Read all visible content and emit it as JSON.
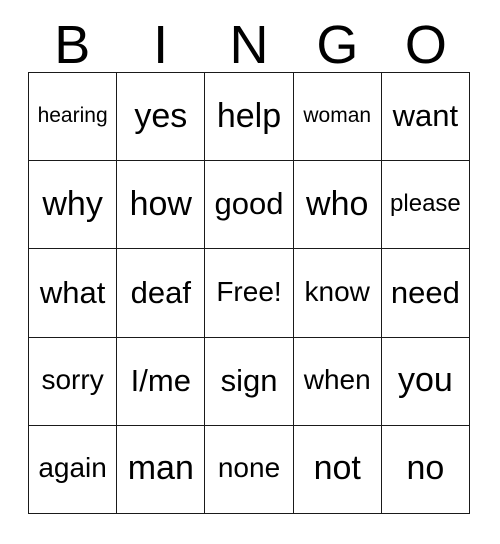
{
  "card": {
    "title_letters": [
      "B",
      "I",
      "N",
      "G",
      "O"
    ],
    "columns": 5,
    "rows": 5,
    "free_space_label": "Free!",
    "colors": {
      "background": "#ffffff",
      "border": "#1a1a1a",
      "text": "#000000"
    },
    "grid": [
      [
        {
          "text": "hearing",
          "size": "xs"
        },
        {
          "text": "yes",
          "size": "xl"
        },
        {
          "text": "help",
          "size": "xl"
        },
        {
          "text": "woman",
          "size": "xs"
        },
        {
          "text": "want",
          "size": "lg"
        }
      ],
      [
        {
          "text": "why",
          "size": "xl"
        },
        {
          "text": "how",
          "size": "xl"
        },
        {
          "text": "good",
          "size": "lg"
        },
        {
          "text": "who",
          "size": "xl"
        },
        {
          "text": "please",
          "size": "sm"
        }
      ],
      [
        {
          "text": "what",
          "size": "lg"
        },
        {
          "text": "deaf",
          "size": "lg"
        },
        {
          "text": "Free!",
          "size": "md"
        },
        {
          "text": "know",
          "size": "md"
        },
        {
          "text": "need",
          "size": "lg"
        }
      ],
      [
        {
          "text": "sorry",
          "size": "md"
        },
        {
          "text": "I/me",
          "size": "lg"
        },
        {
          "text": "sign",
          "size": "lg"
        },
        {
          "text": "when",
          "size": "md"
        },
        {
          "text": "you",
          "size": "xl"
        }
      ],
      [
        {
          "text": "again",
          "size": "md"
        },
        {
          "text": "man",
          "size": "xl"
        },
        {
          "text": "none",
          "size": "md"
        },
        {
          "text": "not",
          "size": "xl"
        },
        {
          "text": "no",
          "size": "xl"
        }
      ]
    ]
  }
}
